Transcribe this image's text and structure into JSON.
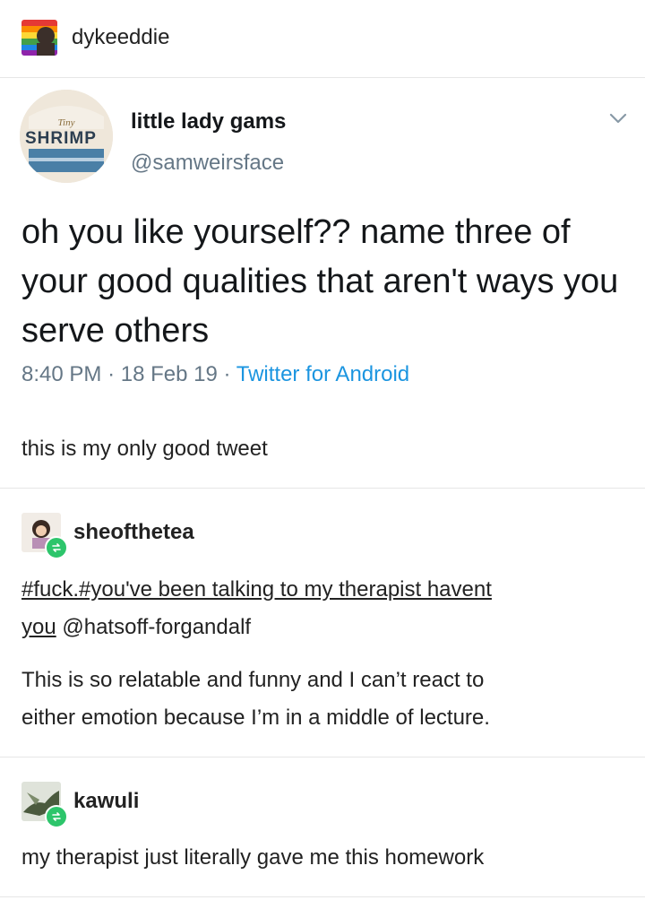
{
  "op": {
    "username": "dykeeddie"
  },
  "tweet": {
    "avatar_text": "SHRIMP",
    "display_name": "little lady gams",
    "handle": "@samweirsface",
    "text": "oh you like yourself?? name three of your good qualities that aren't ways you serve others",
    "time": "8:40 PM",
    "date": "18 Feb 19",
    "separator": "·",
    "client": "Twitter for Android"
  },
  "op_caption": "this is my only good tweet",
  "comments": [
    {
      "username": "sheofthetea",
      "tags_line1": "#fuck.#you've been talking to my therapist havent",
      "tags_line2_link": "you",
      "mention": "@hatsoff-forgandalf",
      "text_line1": "This is so relatable and funny and I can’t react to",
      "text_line2": "either emotion because I’m in a middle of lecture."
    },
    {
      "username": "kawuli",
      "text": "my therapist just literally gave me this homework"
    }
  ],
  "colors": {
    "twitter_link": "#1b95e0",
    "twitter_meta": "#657786",
    "reblog_green": "#2dc56b"
  }
}
